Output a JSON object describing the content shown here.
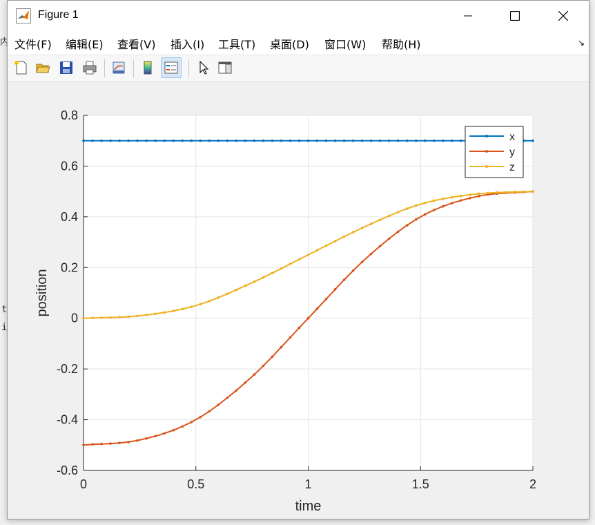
{
  "window": {
    "title": "Figure 1"
  },
  "menu": [
    {
      "label": "文件(F)"
    },
    {
      "label": "编辑(E)"
    },
    {
      "label": "查看(V)"
    },
    {
      "label": "插入(I)"
    },
    {
      "label": "工具(T)"
    },
    {
      "label": "桌面(D)"
    },
    {
      "label": "窗口(W)"
    },
    {
      "label": "帮助(H)"
    }
  ],
  "menu_overflow_icon": "undock-arrow-icon",
  "toolbar": [
    {
      "icon": "new-figure-icon"
    },
    {
      "icon": "open-file-icon"
    },
    {
      "icon": "save-icon"
    },
    {
      "icon": "print-icon"
    },
    {
      "icon": "link-plot-icon"
    },
    {
      "icon": "colorbar-icon"
    },
    {
      "icon": "legend-icon",
      "active": true
    },
    {
      "icon": "pointer-icon"
    },
    {
      "icon": "property-editor-icon"
    }
  ],
  "chart_data": {
    "type": "line",
    "xlabel": "time",
    "ylabel": "position",
    "xlim": [
      0,
      2
    ],
    "ylim": [
      -0.6,
      0.8
    ],
    "xticks": [
      "0",
      "0.5",
      "1",
      "1.5",
      "2"
    ],
    "yticks": [
      "-0.6",
      "-0.4",
      "-0.2",
      "0",
      "0.2",
      "0.4",
      "0.6",
      "0.8"
    ],
    "grid": true,
    "legend_position": "top-right",
    "series": [
      {
        "name": "x",
        "color": "#0072BD",
        "x": [
          0,
          0.25,
          0.5,
          0.75,
          1,
          1.25,
          1.5,
          1.75,
          2
        ],
        "y": [
          0.7,
          0.7,
          0.7,
          0.7,
          0.7,
          0.7,
          0.7,
          0.7,
          0.7
        ]
      },
      {
        "name": "y",
        "color": "#D95319",
        "x": [
          0,
          0.25,
          0.5,
          0.75,
          1,
          1.25,
          1.5,
          1.75,
          2
        ],
        "y": [
          -0.5,
          -0.48,
          -0.4,
          -0.23,
          0,
          0.23,
          0.4,
          0.48,
          0.5
        ]
      },
      {
        "name": "z",
        "color": "#EDB120",
        "x": [
          0,
          0.25,
          0.5,
          0.75,
          1,
          1.25,
          1.5,
          1.75,
          2
        ],
        "y": [
          0,
          0.01,
          0.05,
          0.14,
          0.25,
          0.36,
          0.45,
          0.49,
          0.5
        ]
      }
    ]
  }
}
